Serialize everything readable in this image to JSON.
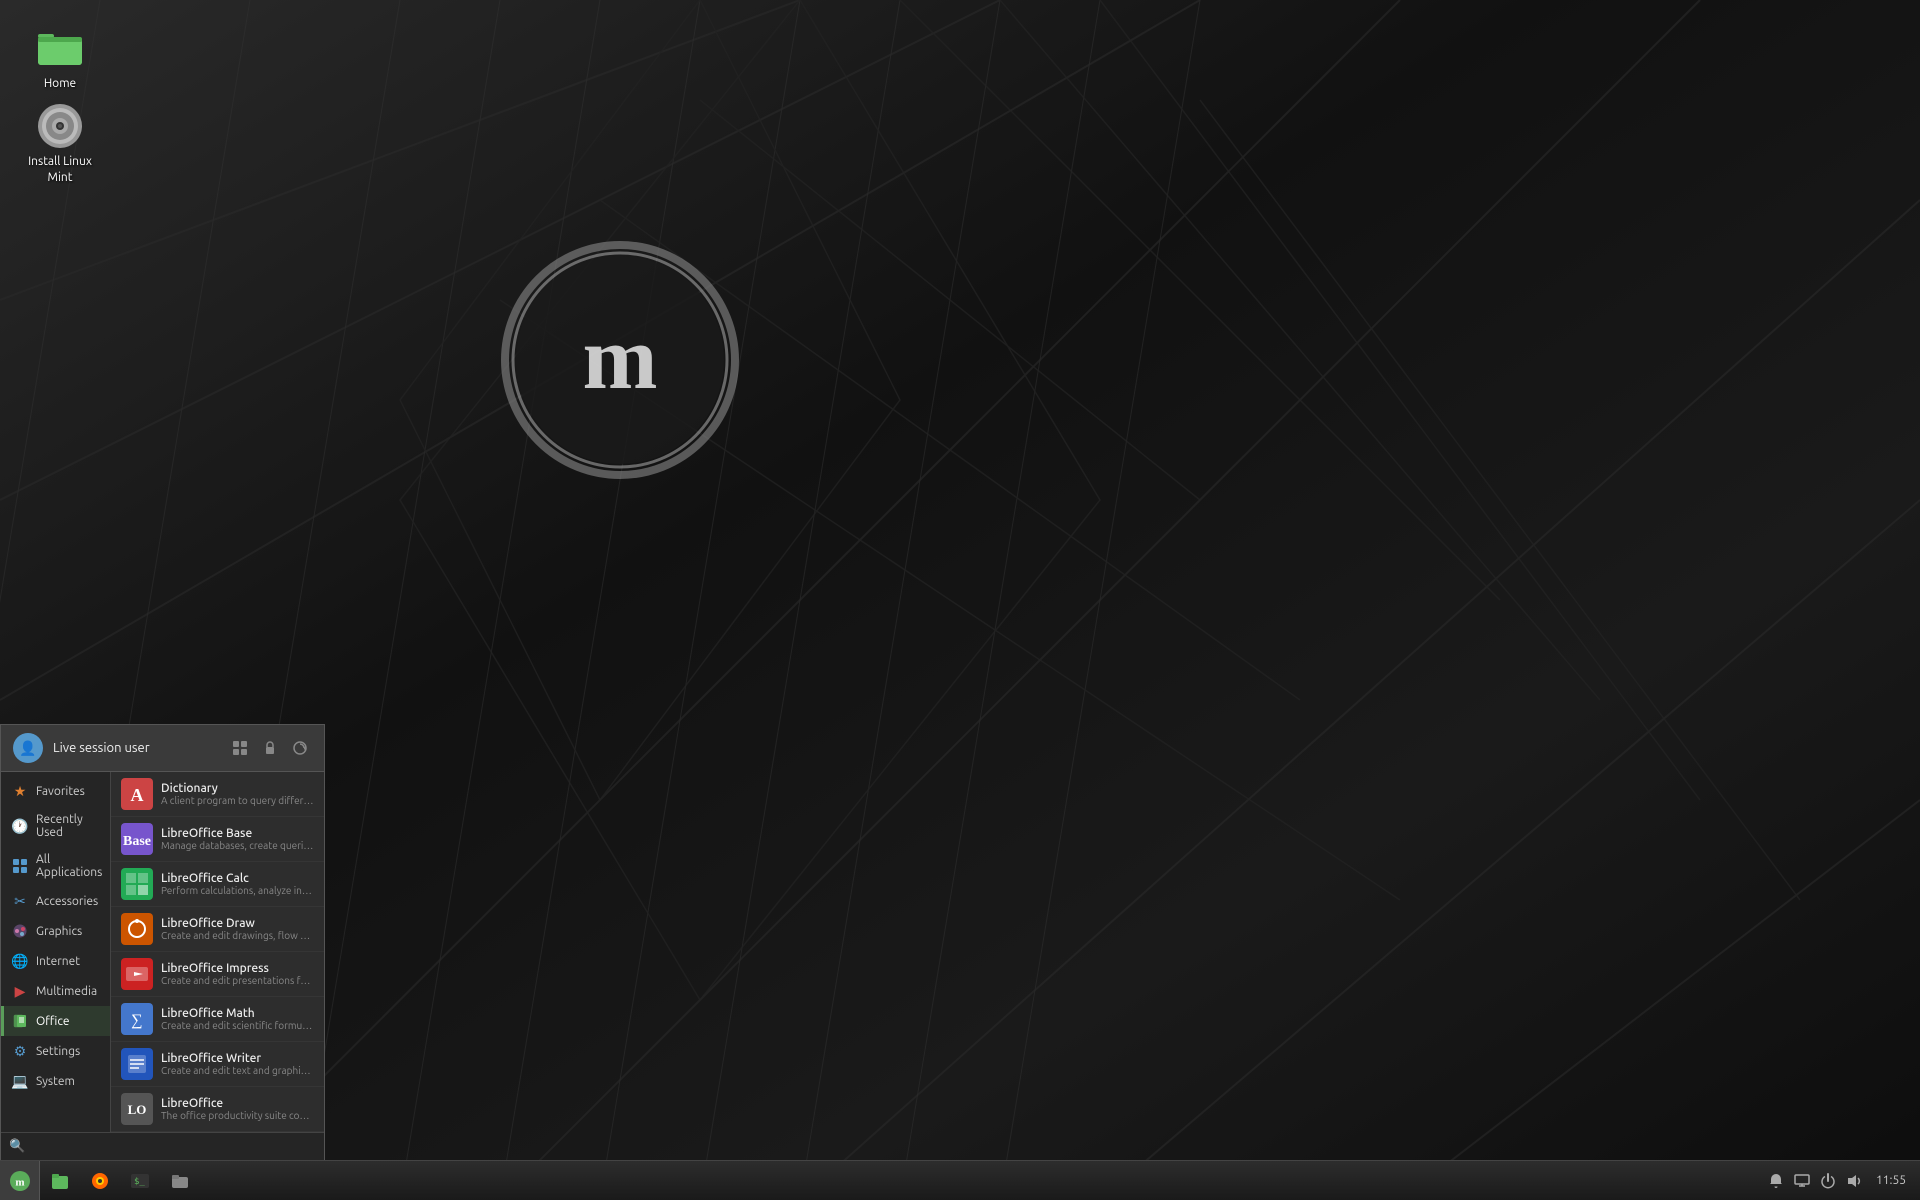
{
  "desktop": {
    "icons": [
      {
        "id": "home",
        "label": "Home",
        "type": "folder"
      },
      {
        "id": "install-mint",
        "label": "Install Linux\nMint",
        "type": "dvd"
      }
    ]
  },
  "taskbar": {
    "clock": "11:55",
    "system_tray_icons": [
      "bell",
      "display",
      "power",
      "volume"
    ]
  },
  "start_menu": {
    "header": {
      "username": "Live session user",
      "actions": [
        "software-manager",
        "lock-screen",
        "logout"
      ]
    },
    "sidebar": [
      {
        "id": "favorites",
        "label": "Favorites",
        "icon": "★",
        "color": "orange"
      },
      {
        "id": "recently-used",
        "label": "Recently Used",
        "icon": "🕐",
        "color": "blue"
      },
      {
        "id": "all-applications",
        "label": "All Applications",
        "icon": "⊞",
        "color": "blue"
      },
      {
        "id": "accessories",
        "label": "Accessories",
        "icon": "✂",
        "color": "blue"
      },
      {
        "id": "graphics",
        "label": "Graphics",
        "icon": "🎨",
        "color": "purple"
      },
      {
        "id": "internet",
        "label": "Internet",
        "icon": "🌐",
        "color": "blue"
      },
      {
        "id": "multimedia",
        "label": "Multimedia",
        "icon": "▶",
        "color": "red"
      },
      {
        "id": "office",
        "label": "Office",
        "icon": "📄",
        "color": "green",
        "active": true
      },
      {
        "id": "settings",
        "label": "Settings",
        "icon": "⚙",
        "color": "blue"
      },
      {
        "id": "system",
        "label": "System",
        "icon": "💻",
        "color": "blue"
      }
    ],
    "apps": [
      {
        "id": "dictionary",
        "name": "Dictionary",
        "desc": "A client program to query different dicti...",
        "icon_type": "dict",
        "icon_char": "A"
      },
      {
        "id": "libreoffice-base",
        "name": "LibreOffice Base",
        "desc": "Manage databases, create queries and r...",
        "icon_type": "base",
        "icon_char": "B"
      },
      {
        "id": "libreoffice-calc",
        "name": "LibreOffice Calc",
        "desc": "Perform calculations, analyze informatio...",
        "icon_type": "calc",
        "icon_char": "C"
      },
      {
        "id": "libreoffice-draw",
        "name": "LibreOffice Draw",
        "desc": "Create and edit drawings, flow charts an...",
        "icon_type": "draw",
        "icon_char": "D"
      },
      {
        "id": "libreoffice-impress",
        "name": "LibreOffice Impress",
        "desc": "Create and edit presentations for slides...",
        "icon_type": "impress",
        "icon_char": "I"
      },
      {
        "id": "libreoffice-math",
        "name": "LibreOffice Math",
        "desc": "Create and edit scientific formulas and e...",
        "icon_type": "math",
        "icon_char": "M"
      },
      {
        "id": "libreoffice-writer",
        "name": "LibreOffice Writer",
        "desc": "Create and edit text and graphics in lett...",
        "icon_type": "writer",
        "icon_char": "W"
      },
      {
        "id": "libreoffice",
        "name": "LibreOffice",
        "desc": "The office productivity suite compatible...",
        "icon_type": "lo",
        "icon_char": "L"
      }
    ],
    "search_placeholder": ""
  }
}
